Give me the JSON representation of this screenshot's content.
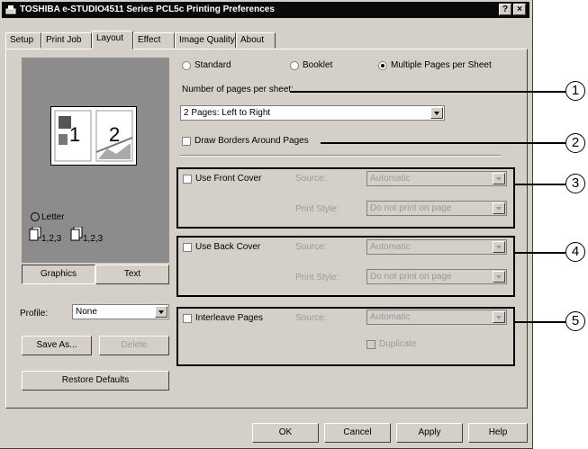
{
  "window": {
    "title": "TOSHIBA e-STUDIO4511 Series PCL5c Printing Preferences",
    "help_btn": "?",
    "close_btn": "×"
  },
  "tabs": [
    "Setup",
    "Print Job",
    "Layout",
    "Effect",
    "Image Quality",
    "About"
  ],
  "preview": {
    "page1": "1",
    "page2": "2",
    "paper": "Letter",
    "stack1": "1,2,3",
    "stack2": "1,2,3"
  },
  "view_buttons": {
    "graphics": "Graphics",
    "text": "Text"
  },
  "profile": {
    "label": "Profile:",
    "value": "None",
    "save_as": "Save As...",
    "delete": "Delete",
    "restore": "Restore Defaults"
  },
  "layout_mode": {
    "standard": "Standard",
    "booklet": "Booklet",
    "multiple": "Multiple Pages per Sheet",
    "selected": "Multiple Pages per Sheet"
  },
  "pages_per_sheet": {
    "label": "Number of pages per sheet:",
    "value": "2 Pages: Left to Right"
  },
  "draw_borders": "Draw Borders Around Pages",
  "front_cover": {
    "label": "Use Front Cover",
    "source_label": "Source:",
    "source_value": "Automatic",
    "style_label": "Print Style:",
    "style_value": "Do not print on page"
  },
  "back_cover": {
    "label": "Use Back Cover",
    "source_label": "Source:",
    "source_value": "Automatic",
    "style_label": "Print Style:",
    "style_value": "Do not print on page"
  },
  "interleave": {
    "label": "Interleave Pages",
    "source_label": "Source:",
    "source_value": "Automatic",
    "duplicate_label": "Duplicate"
  },
  "footer": {
    "ok": "OK",
    "cancel": "Cancel",
    "apply": "Apply",
    "help": "Help"
  },
  "callouts": [
    "1",
    "2",
    "3",
    "4",
    "5"
  ]
}
